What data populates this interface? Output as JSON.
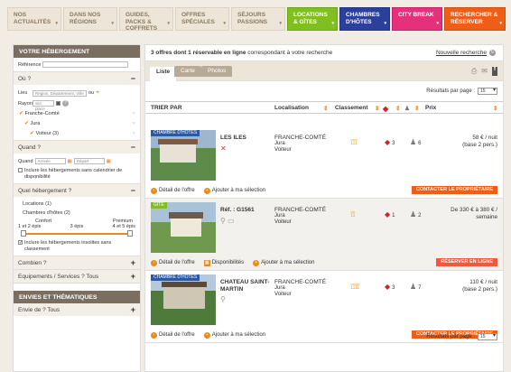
{
  "nav": [
    {
      "label": "Nos actualités"
    },
    {
      "label": "Dans nos régions"
    },
    {
      "label": "Guides, packs & coffrets"
    },
    {
      "label": "Offres spéciales"
    },
    {
      "label": "Séjours passions"
    },
    {
      "label": "Locations & gîtes"
    },
    {
      "label": "Chambres d'hôtes"
    },
    {
      "label": "City break"
    },
    {
      "label": "Rechercher & réserver"
    }
  ],
  "sidebar": {
    "title": "Votre hébergement",
    "reference_label": "Référence",
    "ou": {
      "title": "Où ?",
      "lieu_label": "Lieu",
      "lieu_placeholder": "Région, Département, Ville",
      "ou_word": "ou",
      "rayon_label": "Rayon",
      "rayon_value": "Sur place",
      "tags": [
        "Franche-Comté",
        "Jura",
        "Voiteur (3)"
      ]
    },
    "quand": {
      "title": "Quand ?",
      "label": "Quand",
      "arrivee": "Arrivée",
      "depart": "Départ",
      "flexible": "Inclure les hébergements sans calendrier de disponibilité"
    },
    "quel": {
      "title": "Quel hébergement ?",
      "items": [
        "Locations (1)",
        "Chambres d'hôtes (2)"
      ],
      "scale_left_top": "",
      "scale_mid": "Confort",
      "scale_right_top": "Premium",
      "scale_left": "1 et 2 épis",
      "scale_mid2": "3 épis",
      "scale_right": "4 et 5 épis",
      "insolite": "Inclure les hébergements insolites sans classement"
    },
    "combien": "Combien ?",
    "equipements": "Equipements / Services ?",
    "equipements_value": "Tous",
    "envies_title": "Envies et thématiques",
    "envie_de": "Envie de ?",
    "envie_value": "Tous"
  },
  "main": {
    "result_count": "3 offres dont 1 réservable en ligne",
    "result_suffix": "correspondant à votre recherche",
    "new_search": "Nouvelle recherche",
    "tabs": [
      {
        "label": "Liste"
      },
      {
        "label": "Carte"
      },
      {
        "label": "Photos"
      }
    ],
    "per_page_label": "Résultats par page :",
    "per_page_value": "15",
    "columns": {
      "sort": "TRIER PAR",
      "localisation": "Localisation",
      "classement": "Classement",
      "prix": "Prix"
    },
    "listings": [
      {
        "category": "Chambre d'hôtes",
        "name": "LES ILES",
        "region": "FRANCHE-COMTÉ",
        "dept": "Jura",
        "town": "Voiteur",
        "ears": "⟟⟟⟟",
        "beds": "3",
        "persons": "6",
        "price": "58 € / nuit",
        "price_note": "(base 2 pers.)",
        "link1": "Détail de l'offre",
        "link2": "Ajouter à ma sélection",
        "link3": "",
        "cta": "Contacter le propriétaire"
      },
      {
        "category": "Gîte",
        "name": "Réf. : G1561",
        "region": "FRANCHE-COMTÉ",
        "dept": "Jura",
        "town": "Voiteur",
        "ears": "⟟⟟",
        "beds": "1",
        "persons": "2",
        "price": "De 330 € à 380 € /",
        "price_note": "semaine",
        "link1": "Détail de l'offre",
        "link2": "Disponibilités",
        "link3": "Ajouter à ma sélection",
        "cta": "Réserver en ligne"
      },
      {
        "category": "Chambre d'hôtes",
        "name": "CHATEAU SAINT-MARTIN",
        "region": "FRANCHE-COMTÉ",
        "dept": "Jura",
        "town": "Voiteur",
        "ears": "⟟⟟⟟⟟",
        "beds": "3",
        "persons": "7",
        "price": "110 € / nuit",
        "price_note": "(base 2 pers.)",
        "link1": "Détail de l'offre",
        "link2": "Ajouter à ma sélection",
        "link3": "",
        "cta": "Contacter le propriétaire"
      }
    ]
  }
}
